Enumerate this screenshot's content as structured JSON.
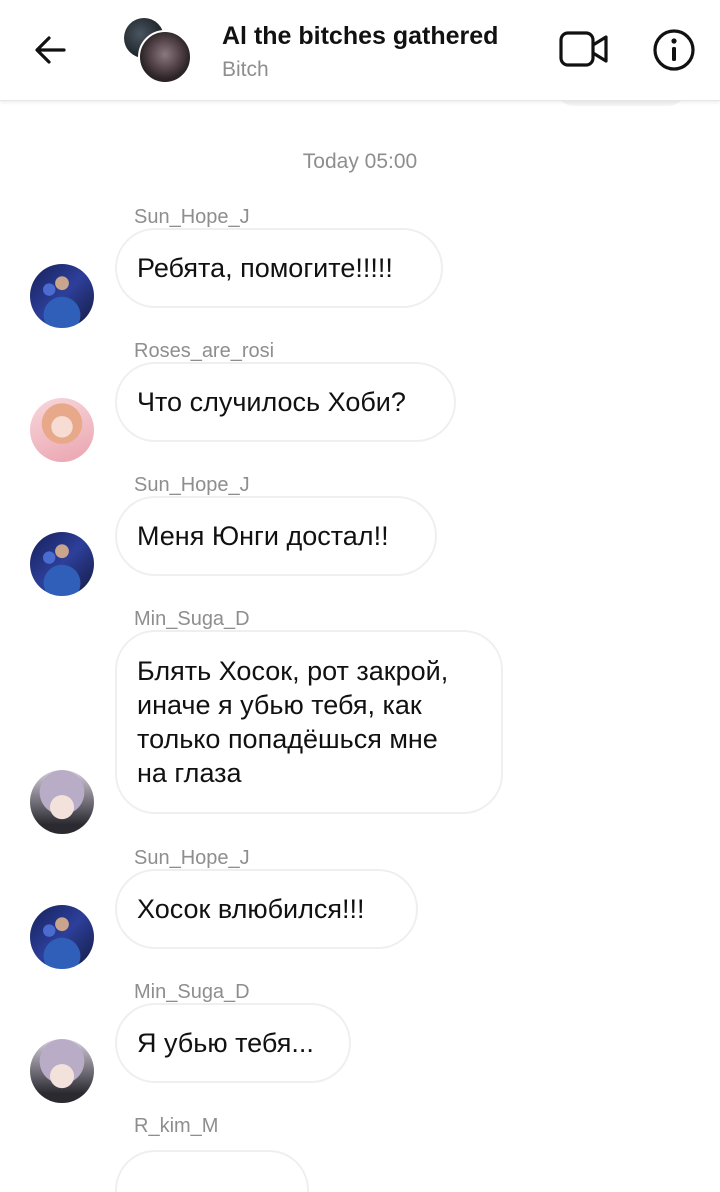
{
  "header": {
    "title": "Al the bitches gathered",
    "subtitle": "Bitch",
    "back_icon": "arrow-left-icon",
    "video_icon": "video-camera-icon",
    "info_icon": "info-icon"
  },
  "timestamp": "Today 05:00",
  "messages": [
    {
      "sender": "Sun_Hope_J",
      "text": "Ребята, помогите!!!!!"
    },
    {
      "sender": "Roses_are_rosi",
      "text": "Что случилось Хоби?"
    },
    {
      "sender": "Sun_Hope_J",
      "text": "Меня Юнги достал!!"
    },
    {
      "sender": "Min_Suga_D",
      "text": "Блять Хосок, рот закрой,\nиначе я убью тебя, как\nтолько попадёшься мне\nна глаза"
    },
    {
      "sender": "Sun_Hope_J",
      "text": "Хосок влюбился!!!"
    },
    {
      "sender": "Min_Suga_D",
      "text": "Я убью тебя..."
    },
    {
      "sender": "R_kim_M",
      "text": ""
    }
  ]
}
